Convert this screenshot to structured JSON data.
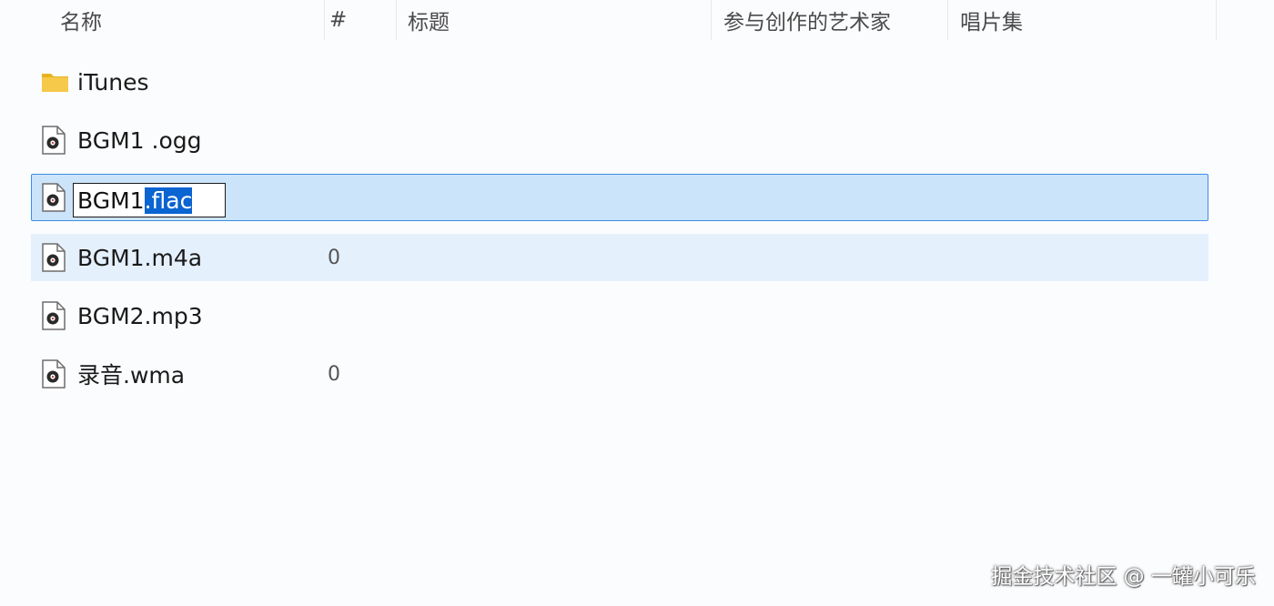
{
  "columns": {
    "name": "名称",
    "number": "#",
    "title": "标题",
    "artist": "参与创作的艺术家",
    "album": "唱片集"
  },
  "files": [
    {
      "name": "iTunes",
      "number": "",
      "type": "folder",
      "state": "normal"
    },
    {
      "name": "BGM1 .ogg",
      "number": "",
      "type": "audio",
      "state": "normal"
    },
    {
      "name": "BGM1.flac",
      "number": "",
      "type": "audio",
      "state": "renaming"
    },
    {
      "name": "BGM1.m4a",
      "number": "0",
      "type": "audio",
      "state": "hover"
    },
    {
      "name": "BGM2.mp3",
      "number": "",
      "type": "audio",
      "state": "normal"
    },
    {
      "name": "录音.wma",
      "number": "0",
      "type": "audio",
      "state": "normal"
    }
  ],
  "rename": {
    "base": "BGM1",
    "selected_ext": ".flac"
  },
  "icons": {
    "folder": "folder-icon",
    "audio": "audio-file-icon"
  },
  "colors": {
    "selection_bg": "#cce4fa",
    "selection_border": "#3d8ee6",
    "hover_bg": "#e5f0fd",
    "text_selection": "#0a64d2",
    "folder": "#f4c542"
  },
  "watermark": "掘金技术社区 @ 一罐小可乐"
}
